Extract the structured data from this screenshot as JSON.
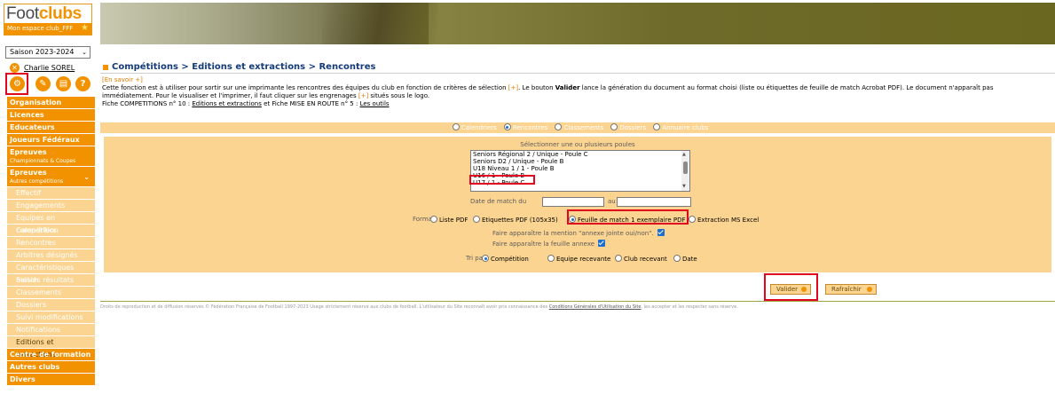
{
  "brand": {
    "name_part1": "Foot",
    "name_part2": "clubs",
    "subtitle": "Mon espace club_FFF"
  },
  "season": {
    "selected": "Saison 2023-2024"
  },
  "user": {
    "name": "Charlie SOREL"
  },
  "menu": {
    "heads": [
      "Organisation",
      "Licences",
      "Educateurs",
      "Joueurs Fédéraux"
    ],
    "epreuves1": {
      "label": "Epreuves",
      "sub": "Championnats & Coupes"
    },
    "epreuves2": {
      "label": "Epreuves",
      "sub": "Autres compétitions"
    },
    "sub_items": [
      "Effectif",
      "Engagements",
      "Equipes en compétition",
      "Calendriers",
      "Rencontres",
      "Arbitres désignés",
      "Caractéristiques match",
      "Saisies résultats",
      "Classements",
      "Dossiers",
      "Suivi modifications",
      "Notifications",
      "Editions et extractions"
    ],
    "tail": [
      "Centre de formation",
      "Autres clubs",
      "Divers"
    ]
  },
  "breadcrumb": "Compétitions > Editions et extractions > Rencontres",
  "en_savoir": "[En savoir +]",
  "info": {
    "p1a": "Cette fonction est à utiliser pour sortir sur une imprimante les rencontres des équipes du club en fonction de critères de sélection ",
    "plus": "[+]",
    "p1b": ". Le bouton ",
    "valider_bold": "Valider",
    "p1c": " lance la génération du document au format choisi (liste ou étiquettes de feuille de match Acrobat PDF). Le document n'apparaît pas",
    "p2a": "immédiatement. Pour le visualiser et l'imprimer, il faut cliquer sur les engrenages ",
    "p2b": " situés sous le logo.",
    "p3a": "Fiche COMPETITIONS n° 10 : ",
    "p3link1": "Editions et extractions",
    "p3b": " et Fiche MISE EN ROUTE n° 5 : ",
    "p3link2": "Les outils"
  },
  "top_radios": {
    "items": [
      "Calendriers",
      "Rencontres",
      "Classements",
      "Dossiers",
      "Annuaire clubs"
    ],
    "selected": "Rencontres"
  },
  "form": {
    "poules_label": "Sélectionner une ou plusieurs poules",
    "poules": [
      "Seniors Régional 2 / Unique - Poule C",
      "Seniors D2 / Unique - Poule B",
      "U18 Niveau 1 / 1 - Poule B",
      "U16 / 1 - Poule B",
      "U17 / 1 - Poule C"
    ],
    "date_label": "Date de match du",
    "date_to": "au",
    "format_label": "Format",
    "formats": [
      "Liste PDF",
      "Etiquettes PDF (105x35)",
      "Feuille de match 1 exemplaire PDF",
      "Extraction MS Excel"
    ],
    "format_selected": "Feuille de match 1 exemplaire PDF",
    "annexe_mention": "Faire apparaître la mention \"annexe jointe oui/non\".",
    "annexe_feuille": "Faire apparaître la feuille annexe",
    "tri_label": "Tri par",
    "tri": [
      "Compétition",
      "Equipe recevante",
      "Club recevant",
      "Date"
    ],
    "tri_selected": "Compétition"
  },
  "buttons": {
    "valider": "Valider",
    "rafraichir": "Rafraîchir"
  },
  "footer": {
    "text": "Droits de reproduction et de diffusion réservés © Fédération Française de Football 1997-2023 Usage strictement réservé aux clubs de football. L'utilisateur du Site reconnaît avoir pris connaissance des ",
    "link": "Conditions Générales d'Utilisation du Site",
    "text2": ", les accepter et les respecter sans réserve."
  },
  "colors": {
    "accent": "#f39200",
    "light": "#fbd491",
    "highlight": "#e0061e",
    "title": "#143b7a"
  }
}
